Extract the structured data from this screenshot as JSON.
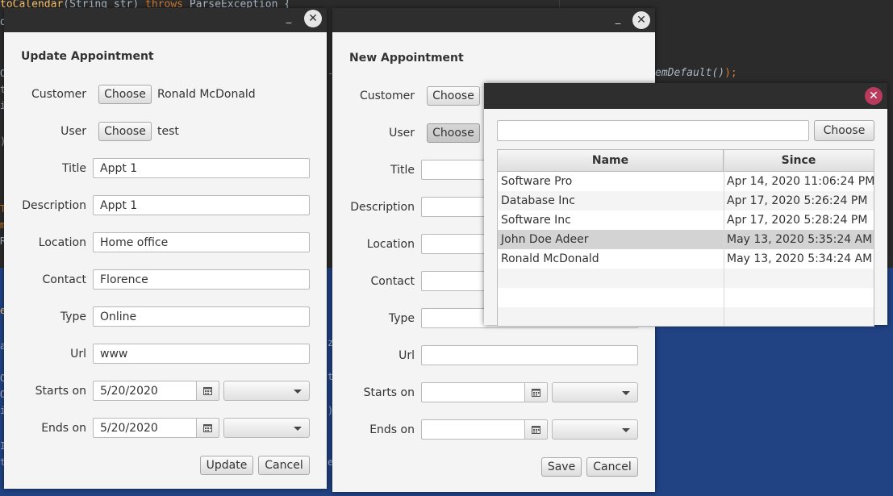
{
  "ide": {
    "line1_name": "toCalendar",
    "line1_args": "(String str) ",
    "line1_throws": "throws",
    "line1_exc": " ParseException {",
    "line2": "d",
    "right_snippet_a": "emDefault()",
    "right_snippet_b": ");"
  },
  "update_dialog": {
    "heading": "Update Appointment",
    "customer_label": "Customer",
    "customer_choose": "Choose",
    "customer_value": "Ronald McDonald",
    "user_label": "User",
    "user_choose": "Choose",
    "user_value": "test",
    "title_label": "Title",
    "title_value": "Appt 1",
    "description_label": "Description",
    "description_value": "Appt 1",
    "location_label": "Location",
    "location_value": "Home office",
    "contact_label": "Contact",
    "contact_value": "Florence",
    "type_label": "Type",
    "type_value": "Online",
    "url_label": "Url",
    "url_value": "www",
    "starts_label": "Starts on",
    "starts_value": "5/20/2020",
    "ends_label": "Ends on",
    "ends_value": "5/20/2020",
    "update_button": "Update",
    "cancel_button": "Cancel"
  },
  "new_dialog": {
    "heading": "New Appointment",
    "customer_label": "Customer",
    "customer_choose": "Choose",
    "user_label": "User",
    "user_choose": "Choose",
    "title_label": "Title",
    "description_label": "Description",
    "location_label": "Location",
    "contact_label": "Contact",
    "type_label": "Type",
    "url_label": "Url",
    "starts_label": "Starts on",
    "ends_label": "Ends on",
    "save_button": "Save",
    "cancel_button": "Cancel"
  },
  "chooser": {
    "search_value": "",
    "choose_button": "Choose",
    "columns": [
      "Name",
      "Since"
    ],
    "rows": [
      {
        "name": "Software Pro",
        "since": "Apr 14, 2020 11:06:24 PM"
      },
      {
        "name": "Database Inc",
        "since": "Apr 17, 2020 5:26:24 PM"
      },
      {
        "name": "Software Inc",
        "since": "Apr 17, 2020 5:28:24 PM"
      },
      {
        "name": "John Doe Adeer",
        "since": "May 13, 2020 5:35:24 AM"
      },
      {
        "name": "Ronald McDonald",
        "since": "May 13, 2020 5:34:24 AM"
      }
    ],
    "selected_row_index": 3
  },
  "window_controls": {
    "minimize_glyph": "_",
    "close_glyph": "✕"
  },
  "colors": {
    "titlebar": "#2e2e2e",
    "dialog_bg": "#f4f4f4",
    "ide_bg": "#2b2b2b",
    "ide_selection": "#214283",
    "close_accent": "#b83b5e",
    "selected_row": "#d3d3d3"
  }
}
